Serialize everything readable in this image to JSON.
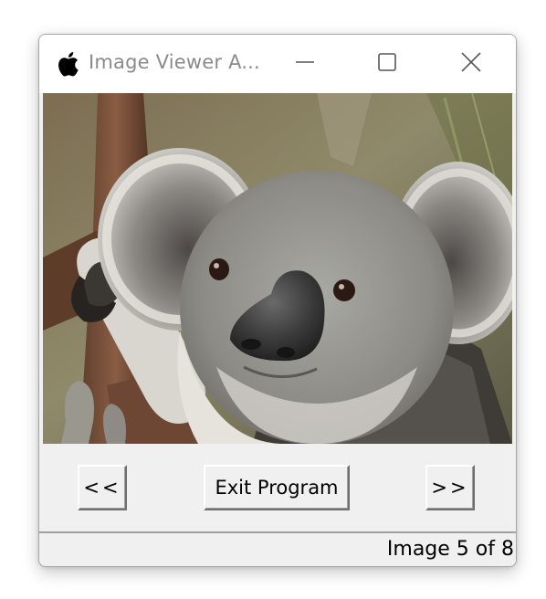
{
  "window": {
    "title": "Image Viewer A...",
    "app_icon": "apple-logo-icon",
    "controls": {
      "minimize_icon": "minimize-icon",
      "maximize_icon": "maximize-icon",
      "close_icon": "close-icon"
    }
  },
  "viewer": {
    "image_subject": "koala"
  },
  "navigation": {
    "prev_label": "<<",
    "exit_label": "Exit Program",
    "next_label": ">>"
  },
  "status": {
    "text": "Image 5 of 8"
  }
}
